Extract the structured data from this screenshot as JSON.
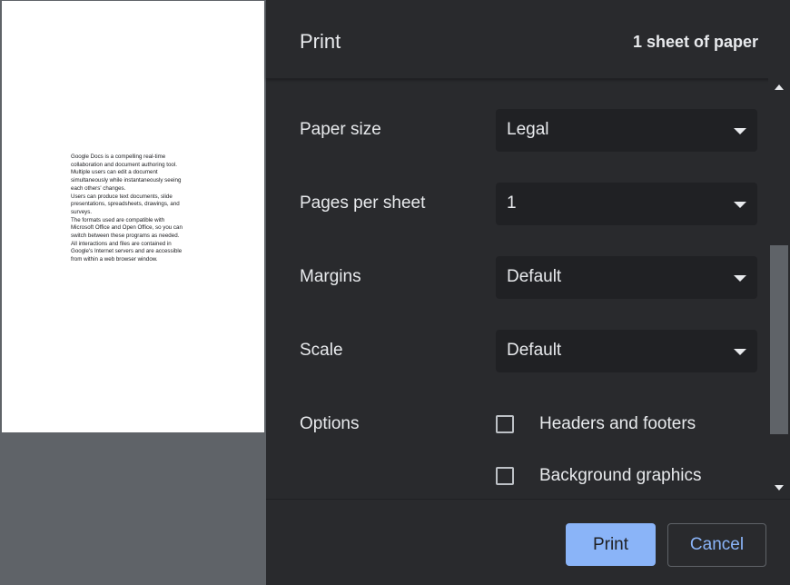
{
  "header": {
    "title": "Print",
    "sheet_count": "1 sheet of paper"
  },
  "preview": {
    "lines": [
      "Google Docs is a compelling real-time",
      "collaboration and document authoring tool.",
      "Multiple users can edit a document",
      "simultaneously while instantaneously seeing",
      "each others' changes.",
      "Users can produce text documents, slide",
      "presentations, spreadsheets, drawings, and",
      "surveys.",
      "The formats used are compatible with",
      "Microsoft Office and Open Office, so you can",
      "switch between these programs as needed.",
      "All interactions and files are contained in",
      "Google's Internet servers and are accessible",
      "from within a web browser window."
    ]
  },
  "settings": {
    "paper_size": {
      "label": "Paper size",
      "value": "Legal"
    },
    "pages_per_sheet": {
      "label": "Pages per sheet",
      "value": "1"
    },
    "margins": {
      "label": "Margins",
      "value": "Default"
    },
    "scale": {
      "label": "Scale",
      "value": "Default"
    },
    "options": {
      "label": "Options",
      "headers_footers": {
        "label": "Headers and footers",
        "checked": false
      },
      "background_graphics": {
        "label": "Background graphics",
        "checked": false
      }
    }
  },
  "footer": {
    "print_label": "Print",
    "cancel_label": "Cancel"
  },
  "colors": {
    "panel_bg": "#292a2d",
    "select_bg": "#202124",
    "accent": "#8ab4f8",
    "text": "#e8eaed",
    "preview_bg": "#5f6368"
  }
}
